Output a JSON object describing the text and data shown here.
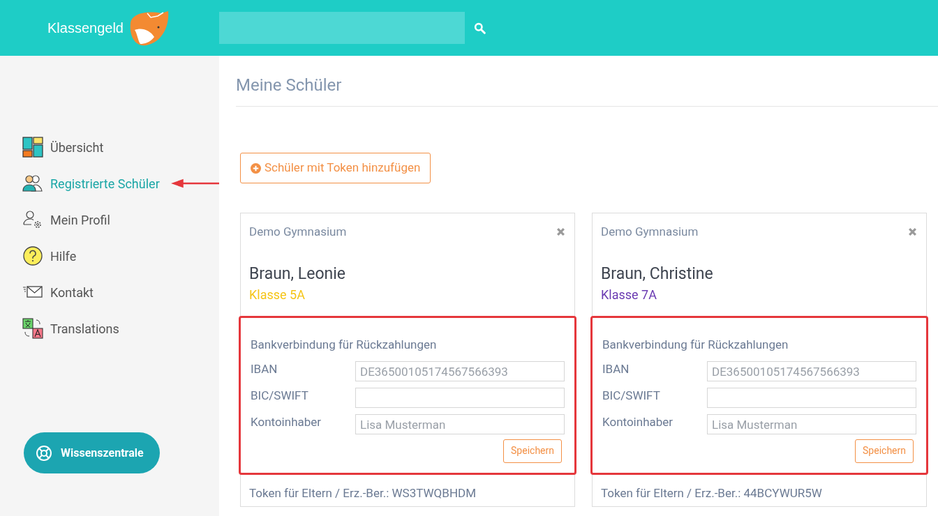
{
  "header": {
    "logo_text": "Klassengeld"
  },
  "sidebar": {
    "items": [
      {
        "label": "Übersicht",
        "kind": "dashboard",
        "selected": false
      },
      {
        "label": "Registrierte Schüler",
        "kind": "users",
        "selected": true
      },
      {
        "label": "Mein Profil",
        "kind": "profile",
        "selected": false
      },
      {
        "label": "Hilfe",
        "kind": "help",
        "selected": false
      },
      {
        "label": "Kontakt",
        "kind": "mail",
        "selected": false
      },
      {
        "label": "Translations",
        "kind": "translate",
        "selected": false
      }
    ],
    "help_button": "Wissenszentrale"
  },
  "page_title": "Meine Schüler",
  "add_button": "Schüler mit Token hinzufügen",
  "students": [
    {
      "school": "Demo Gymnasium",
      "name": "Braun, Leonie",
      "class": "Klasse 5A",
      "color": "#f5c518",
      "bank": {
        "highlighted": true,
        "title": "Bankverbindung für Rückzahlungen",
        "fields": [
          {
            "label": "IBAN",
            "placeholder": "DE36500105174567566393"
          },
          {
            "label": "BIC/SWIFT"
          },
          {
            "label": "Kontoinhaber",
            "placeholder": "Lisa Musterman"
          }
        ],
        "save": "Speichern"
      },
      "token": "Token für Eltern / Erz.-Ber.: WS3TWQBHDM"
    },
    {
      "school": "Demo Gymnasium",
      "name": "Braun, Christine",
      "class": "Klasse 7A",
      "color": "#6a3ab2",
      "bank": {
        "highlighted": true,
        "title": "Bankverbindung für Rückzahlungen",
        "fields": [
          {
            "label": "IBAN",
            "placeholder": "DE36500105174567566393"
          },
          {
            "label": "BIC/SWIFT"
          },
          {
            "label": "Kontoinhaber",
            "placeholder": "Lisa Musterman"
          }
        ],
        "save": "Speichern"
      },
      "token": "Token für Eltern / Erz.-Ber.: 44BCYWUR5W"
    }
  ]
}
